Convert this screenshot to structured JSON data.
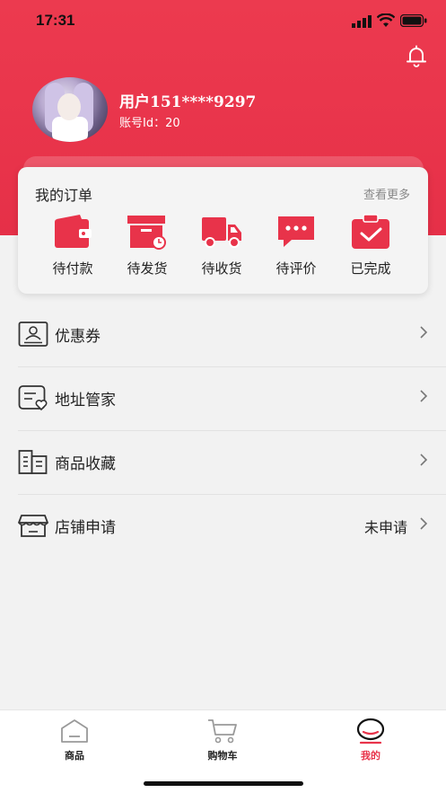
{
  "status_bar": {
    "time": "17:31"
  },
  "profile": {
    "username": "用户151****9297",
    "account_id": "账号Id：20"
  },
  "orders": {
    "title": "我的订单",
    "more": "查看更多",
    "items": [
      {
        "label": "待付款",
        "icon": "wallet-icon"
      },
      {
        "label": "待发货",
        "icon": "box-clock-icon"
      },
      {
        "label": "待收货",
        "icon": "truck-icon"
      },
      {
        "label": "待评价",
        "icon": "comment-icon"
      },
      {
        "label": "已完成",
        "icon": "clipboard-check-icon"
      }
    ]
  },
  "menu": [
    {
      "label": "优惠券",
      "icon": "coupon-icon",
      "value": ""
    },
    {
      "label": "地址管家",
      "icon": "address-icon",
      "value": ""
    },
    {
      "label": "商品收藏",
      "icon": "favorites-icon",
      "value": ""
    },
    {
      "label": "店铺申请",
      "icon": "store-icon",
      "value": "未申请"
    }
  ],
  "tabbar": [
    {
      "label": "商品",
      "icon": "home-icon",
      "active": false
    },
    {
      "label": "购物车",
      "icon": "cart-icon",
      "active": false
    },
    {
      "label": "我的",
      "icon": "profile-icon",
      "active": true
    }
  ],
  "colors": {
    "accent": "#e8334a",
    "background": "#f2f2f2",
    "card": "#f4f4f4",
    "text": "#222222",
    "muted": "#888888"
  }
}
